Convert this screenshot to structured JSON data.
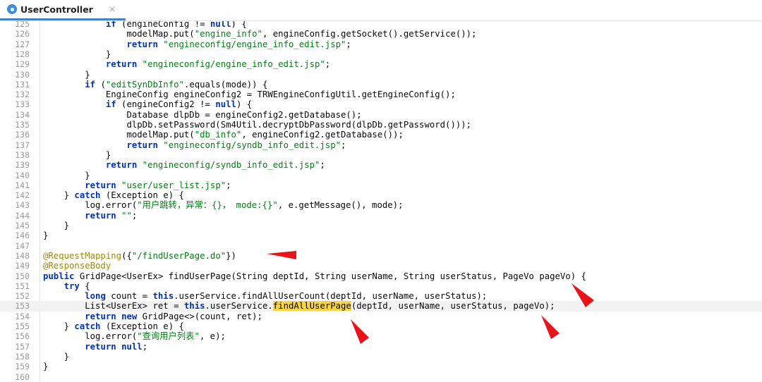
{
  "tab": {
    "title": "UserController",
    "close": "×"
  },
  "lines": [
    {
      "n": "125",
      "parts": [
        {
          "t": "            "
        },
        {
          "t": "if",
          "c": "kw"
        },
        {
          "t": " (engineConfig != "
        },
        {
          "t": "null",
          "c": "kw"
        },
        {
          "t": ") {"
        }
      ]
    },
    {
      "n": "126",
      "parts": [
        {
          "t": "                modelMap.put("
        },
        {
          "t": "\"engine_info\"",
          "c": "str"
        },
        {
          "t": ", engineConfig.getSocket().getService());"
        }
      ]
    },
    {
      "n": "127",
      "parts": [
        {
          "t": "                "
        },
        {
          "t": "return",
          "c": "kw"
        },
        {
          "t": " "
        },
        {
          "t": "\"engineconfig/engine_info_edit.jsp\"",
          "c": "str"
        },
        {
          "t": ";"
        }
      ]
    },
    {
      "n": "128",
      "parts": [
        {
          "t": "            }"
        }
      ]
    },
    {
      "n": "129",
      "parts": [
        {
          "t": "            "
        },
        {
          "t": "return",
          "c": "kw"
        },
        {
          "t": " "
        },
        {
          "t": "\"engineconfig/engine_info_edit.jsp\"",
          "c": "str"
        },
        {
          "t": ";"
        }
      ]
    },
    {
      "n": "130",
      "parts": [
        {
          "t": "        }"
        }
      ]
    },
    {
      "n": "131",
      "parts": [
        {
          "t": "        "
        },
        {
          "t": "if",
          "c": "kw"
        },
        {
          "t": " ("
        },
        {
          "t": "\"editSynDbInfo\"",
          "c": "str"
        },
        {
          "t": ".equals(mode)) {"
        }
      ]
    },
    {
      "n": "132",
      "parts": [
        {
          "t": "            EngineConfig engineConfig2 = TRWEngineConfigUtil.getEngineConfig();"
        }
      ]
    },
    {
      "n": "133",
      "parts": [
        {
          "t": "            "
        },
        {
          "t": "if",
          "c": "kw"
        },
        {
          "t": " (engineConfig2 != "
        },
        {
          "t": "null",
          "c": "kw"
        },
        {
          "t": ") {"
        }
      ]
    },
    {
      "n": "134",
      "parts": [
        {
          "t": "                Database dlpDb = engineConfig2.getDatabase();"
        }
      ]
    },
    {
      "n": "135",
      "parts": [
        {
          "t": "                dlpDb.setPassword(Sm4Util.decryptDbPassword(dlpDb.getPassword()));"
        }
      ]
    },
    {
      "n": "136",
      "parts": [
        {
          "t": "                modelMap.put("
        },
        {
          "t": "\"db_info\"",
          "c": "str"
        },
        {
          "t": ", engineConfig2.getDatabase());"
        }
      ]
    },
    {
      "n": "137",
      "parts": [
        {
          "t": "                "
        },
        {
          "t": "return",
          "c": "kw"
        },
        {
          "t": " "
        },
        {
          "t": "\"engineconfig/syndb_info_edit.jsp\"",
          "c": "str"
        },
        {
          "t": ";"
        }
      ]
    },
    {
      "n": "138",
      "parts": [
        {
          "t": "            }"
        }
      ]
    },
    {
      "n": "139",
      "parts": [
        {
          "t": "            "
        },
        {
          "t": "return",
          "c": "kw"
        },
        {
          "t": " "
        },
        {
          "t": "\"engineconfig/syndb_info_edit.jsp\"",
          "c": "str"
        },
        {
          "t": ";"
        }
      ]
    },
    {
      "n": "140",
      "parts": [
        {
          "t": "        }"
        }
      ]
    },
    {
      "n": "141",
      "parts": [
        {
          "t": "        "
        },
        {
          "t": "return",
          "c": "kw"
        },
        {
          "t": " "
        },
        {
          "t": "\"user/user_list.jsp\"",
          "c": "str"
        },
        {
          "t": ";"
        }
      ]
    },
    {
      "n": "142",
      "parts": [
        {
          "t": "    } "
        },
        {
          "t": "catch",
          "c": "kw"
        },
        {
          "t": " (Exception e) {"
        }
      ]
    },
    {
      "n": "143",
      "parts": [
        {
          "t": "        log.error("
        },
        {
          "t": "\"用户跳转，异常：{}， mode:{}\"",
          "c": "str"
        },
        {
          "t": ", e.getMessage(), mode);"
        }
      ]
    },
    {
      "n": "144",
      "parts": [
        {
          "t": "        "
        },
        {
          "t": "return",
          "c": "kw"
        },
        {
          "t": " "
        },
        {
          "t": "\"\"",
          "c": "str"
        },
        {
          "t": ";"
        }
      ]
    },
    {
      "n": "145",
      "parts": [
        {
          "t": "    }"
        }
      ]
    },
    {
      "n": "146",
      "parts": [
        {
          "t": "}"
        }
      ]
    },
    {
      "n": "147",
      "parts": [
        {
          "t": ""
        }
      ]
    },
    {
      "n": "148",
      "parts": [
        {
          "t": "@RequestMapping",
          "c": "ann"
        },
        {
          "t": "({"
        },
        {
          "t": "\"/findUserPage.do\"",
          "c": "str"
        },
        {
          "t": "})"
        }
      ]
    },
    {
      "n": "149",
      "parts": [
        {
          "t": "@ResponseBody",
          "c": "ann"
        }
      ]
    },
    {
      "n": "150",
      "parts": [
        {
          "t": "public",
          "c": "kw"
        },
        {
          "t": " GridPage<UserEx> findUserPage(String deptId, String userName, String userStatus, PageVo pageVo) {"
        }
      ]
    },
    {
      "n": "151",
      "parts": [
        {
          "t": "    "
        },
        {
          "t": "try",
          "c": "kw"
        },
        {
          "t": " {"
        }
      ]
    },
    {
      "n": "152",
      "parts": [
        {
          "t": "        "
        },
        {
          "t": "long",
          "c": "kw"
        },
        {
          "t": " count = "
        },
        {
          "t": "this",
          "c": "kw"
        },
        {
          "t": ".userService.findAllUserCount(deptId, userName, userStatus);"
        }
      ]
    },
    {
      "n": "153",
      "current": true,
      "parts": [
        {
          "t": "        List<UserEx> ret = "
        },
        {
          "t": "this",
          "c": "kw"
        },
        {
          "t": ".userService."
        },
        {
          "t": "findAllUserPage",
          "c": "hl"
        },
        {
          "t": "(deptId, userName, userStatus, pageVo);"
        }
      ]
    },
    {
      "n": "154",
      "parts": [
        {
          "t": "        "
        },
        {
          "t": "return",
          "c": "kw"
        },
        {
          "t": " "
        },
        {
          "t": "new",
          "c": "kw"
        },
        {
          "t": " GridPage<>(count, ret);"
        }
      ]
    },
    {
      "n": "155",
      "parts": [
        {
          "t": "    } "
        },
        {
          "t": "catch",
          "c": "kw"
        },
        {
          "t": " (Exception e) {"
        }
      ]
    },
    {
      "n": "156",
      "parts": [
        {
          "t": "        log.error("
        },
        {
          "t": "\"查询用户列表\"",
          "c": "str"
        },
        {
          "t": ", e);"
        }
      ]
    },
    {
      "n": "157",
      "parts": [
        {
          "t": "        "
        },
        {
          "t": "return",
          "c": "kw"
        },
        {
          "t": " "
        },
        {
          "t": "null",
          "c": "kw"
        },
        {
          "t": ";"
        }
      ]
    },
    {
      "n": "158",
      "parts": [
        {
          "t": "    }"
        }
      ]
    },
    {
      "n": "159",
      "parts": [
        {
          "t": "}"
        }
      ]
    },
    {
      "n": "160",
      "parts": [
        {
          "t": ""
        }
      ]
    }
  ],
  "colors": {
    "keyword": "#0033b3",
    "string": "#067d17",
    "annotation": "#9e880d",
    "highlight": "#f5d547",
    "arrow": "#e8141a"
  }
}
